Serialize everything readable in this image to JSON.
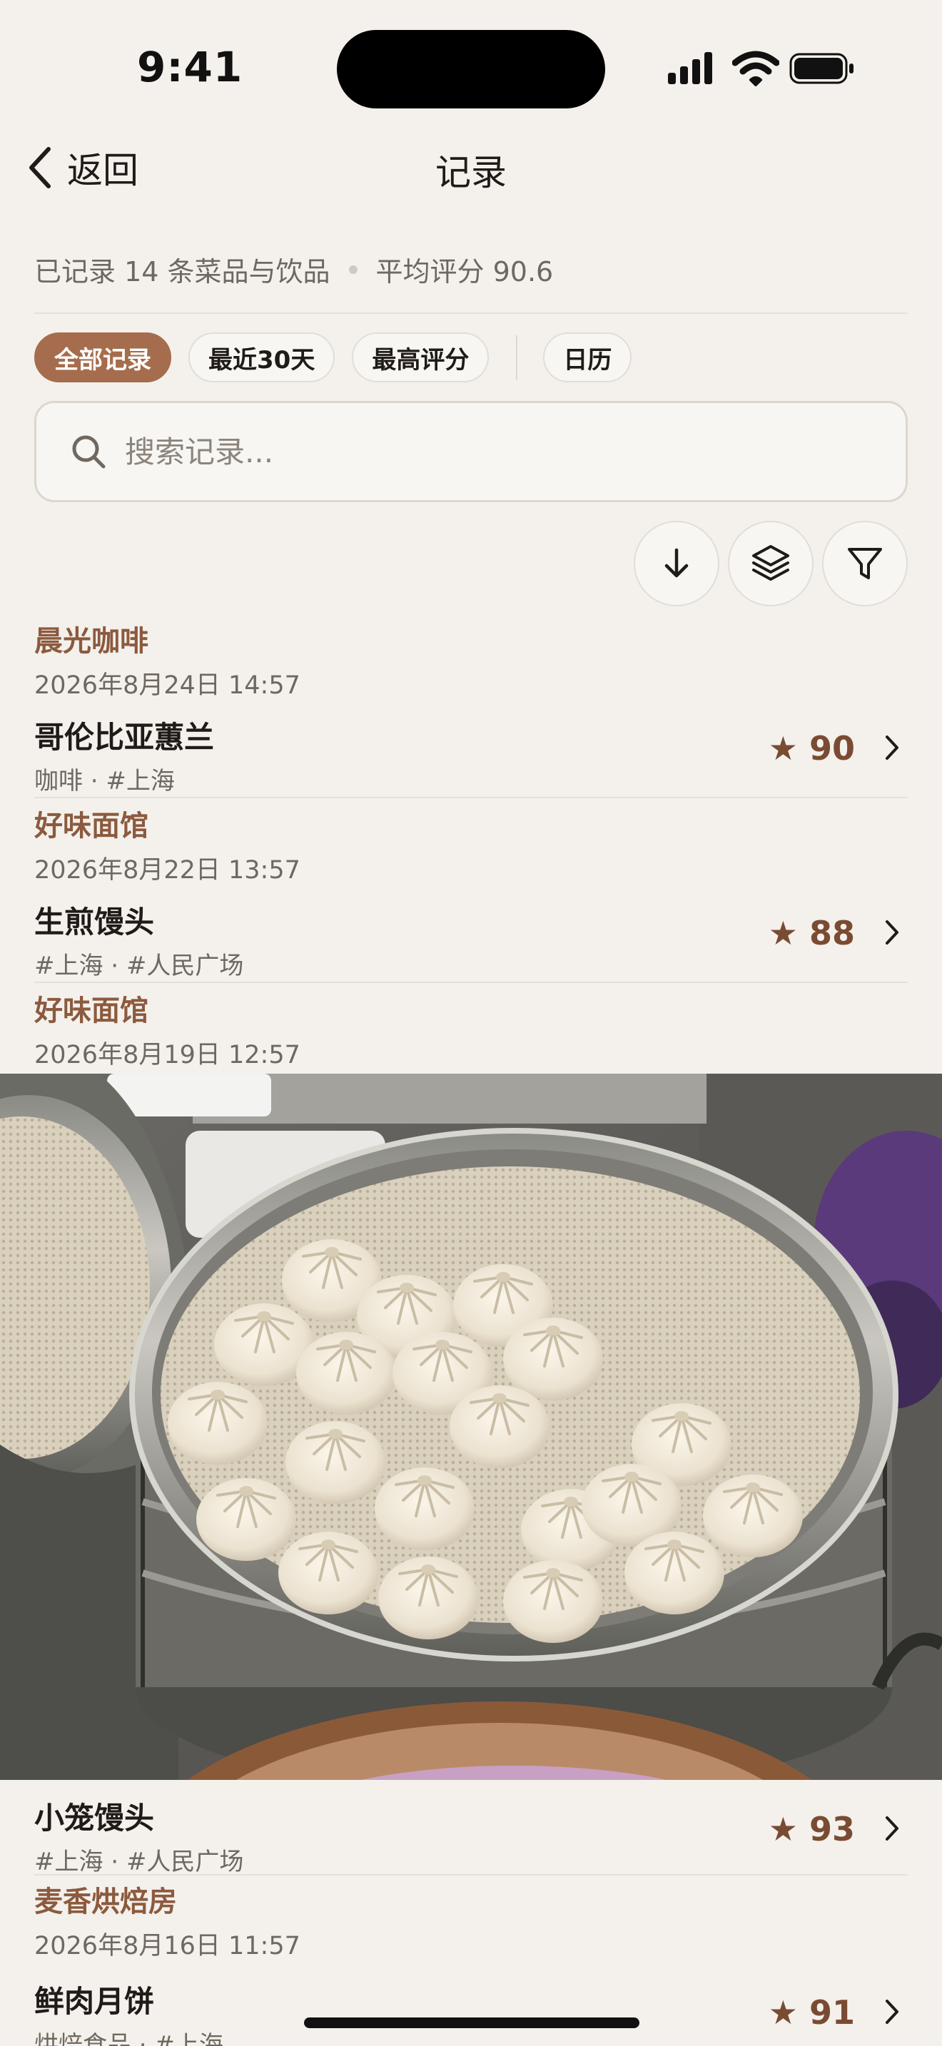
{
  "status_bar": {
    "time": "9:41"
  },
  "nav": {
    "back_label": "返回",
    "title": "记录"
  },
  "summary": {
    "count_text": "已记录 14 条菜品与饮品",
    "avg_text": "平均评分 90.6"
  },
  "filters": {
    "chips": [
      "全部记录",
      "最近30天",
      "最高评分"
    ],
    "calendar": "日历",
    "active_index": 0
  },
  "search": {
    "placeholder": "搜索记录..."
  },
  "records": [
    {
      "place": "晨光咖啡",
      "date": "2026年8月24日 14:57",
      "item": {
        "name": "哥伦比亚蕙兰",
        "tags": "咖啡 · #上海",
        "score": "★ 90"
      }
    },
    {
      "place": "好味面馆",
      "date": "2026年8月22日 13:57",
      "item": {
        "name": "生煎馒头",
        "tags": "#上海 · #人民广场",
        "score": "★ 88"
      }
    },
    {
      "place": "好味面馆",
      "date": "2026年8月19日 12:57",
      "item": {
        "name": "小笼馒头",
        "tags": "#上海 · #人民广场",
        "score": "★ 93"
      }
    },
    {
      "place": "麦香烘焙房",
      "date": "2026年8月16日 11:57",
      "item": {
        "name": "鲜肉月饼",
        "tags": "烘焙食品 · #上海",
        "score": "★ 91"
      }
    }
  ],
  "colors": {
    "background": "#f4f1ec",
    "accent": "#a56d4d",
    "place_title": "#8c5a3e",
    "score": "#7a4b33"
  },
  "icons": [
    "chevron-left-icon",
    "search-icon",
    "sort-down-icon",
    "layers-icon",
    "filter-icon",
    "chevron-right-icon"
  ]
}
